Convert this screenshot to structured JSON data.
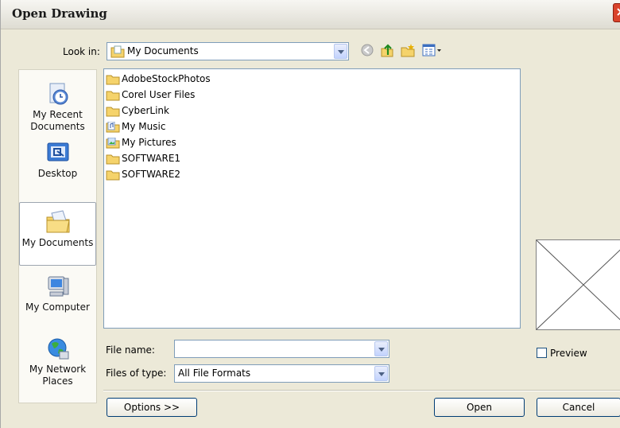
{
  "window": {
    "title": "Open Drawing"
  },
  "look_in": {
    "label": "Look in:",
    "value": "My Documents"
  },
  "places": [
    {
      "label": "My Recent Documents",
      "icon": "recent-documents-icon"
    },
    {
      "label": "Desktop",
      "icon": "desktop-icon"
    },
    {
      "label": "My Documents",
      "icon": "my-documents-icon",
      "selected": true
    },
    {
      "label": "My Computer",
      "icon": "my-computer-icon"
    },
    {
      "label": "My Network Places",
      "icon": "network-places-icon"
    }
  ],
  "files": [
    {
      "name": "AdobeStockPhotos",
      "icon": "folder-icon"
    },
    {
      "name": "Corel User Files",
      "icon": "folder-icon"
    },
    {
      "name": "CyberLink",
      "icon": "folder-icon"
    },
    {
      "name": "My Music",
      "icon": "music-folder-icon"
    },
    {
      "name": "My Pictures",
      "icon": "pictures-folder-icon"
    },
    {
      "name": "SOFTWARE1",
      "icon": "folder-icon"
    },
    {
      "name": "SOFTWARE2",
      "icon": "folder-icon"
    }
  ],
  "file_name": {
    "label": "File name:",
    "value": ""
  },
  "files_of_type": {
    "label": "Files of type:",
    "value": "All File Formats"
  },
  "preview": {
    "label": "Preview",
    "checked": false
  },
  "buttons": {
    "options": "Options >>",
    "open": "Open",
    "cancel": "Cancel"
  },
  "colors": {
    "dialog_bg": "#ece9d8",
    "close": "#d9432b",
    "border_blue": "#7f9db9",
    "folder": "#f5d36b"
  }
}
